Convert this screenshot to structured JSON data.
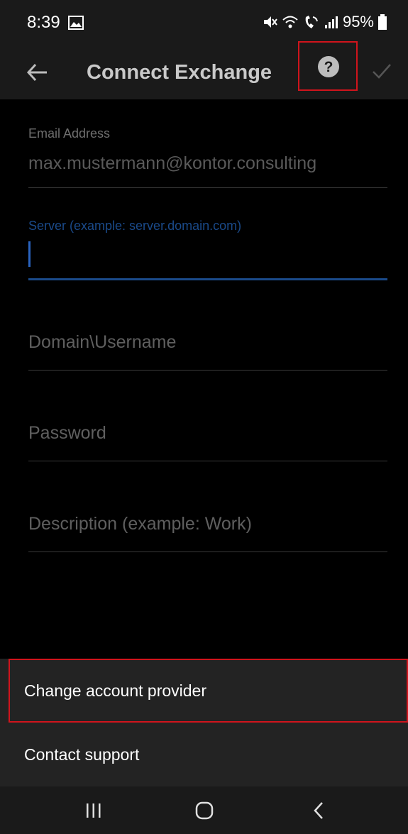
{
  "status_bar": {
    "time": "8:39",
    "battery": "95%",
    "icons": [
      "gallery-icon",
      "mute-icon",
      "wifi-icon",
      "wifi-call-icon",
      "signal-icon",
      "battery-icon"
    ]
  },
  "toolbar": {
    "title": "Connect Exchange",
    "icons": [
      "back-arrow-icon",
      "help-icon",
      "check-icon"
    ]
  },
  "form": {
    "email": {
      "label": "Email Address",
      "value": "max.mustermann@kontor.consulting"
    },
    "server": {
      "label": "Server (example: server.domain.com)",
      "value": ""
    },
    "username": {
      "placeholder": "Domain\\Username"
    },
    "password": {
      "placeholder": "Password"
    },
    "description": {
      "placeholder": "Description (example: Work)"
    }
  },
  "bottom_sheet": {
    "items": [
      {
        "label": "Change account provider"
      },
      {
        "label": "Contact support"
      }
    ]
  },
  "nav_bar": {
    "icons": [
      "recent-apps-icon",
      "home-icon",
      "back-icon"
    ]
  },
  "colors": {
    "accent": "#1a4a8a",
    "highlight_border": "#d0141c",
    "sheet_bg": "#232323",
    "bar_bg": "#1a1a1a"
  }
}
